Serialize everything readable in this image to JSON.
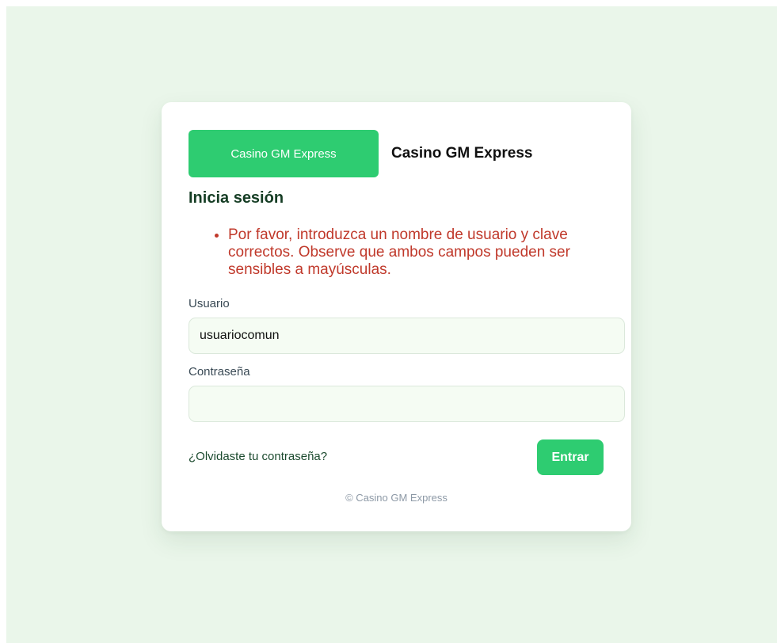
{
  "brand": {
    "logo_text": "Casino GM Express",
    "name": "Casino GM Express",
    "logo_color": "#2ecc71"
  },
  "login": {
    "title": "Inicia sesión",
    "errors": [
      "Por favor, introduzca un nombre de usuario y clave correctos. Observe que ambos campos pueden ser sensibles a mayúsculas."
    ],
    "username": {
      "label": "Usuario",
      "value": "usuariocomun"
    },
    "password": {
      "label": "Contraseña",
      "value": ""
    },
    "forgot_link": "¿Olvidaste tu contraseña?",
    "submit_label": "Entrar"
  },
  "footer": {
    "text": "© Casino GM Express"
  },
  "colors": {
    "accent": "#2ecc71",
    "error": "#c0392b",
    "background": "#eaf6ea"
  }
}
